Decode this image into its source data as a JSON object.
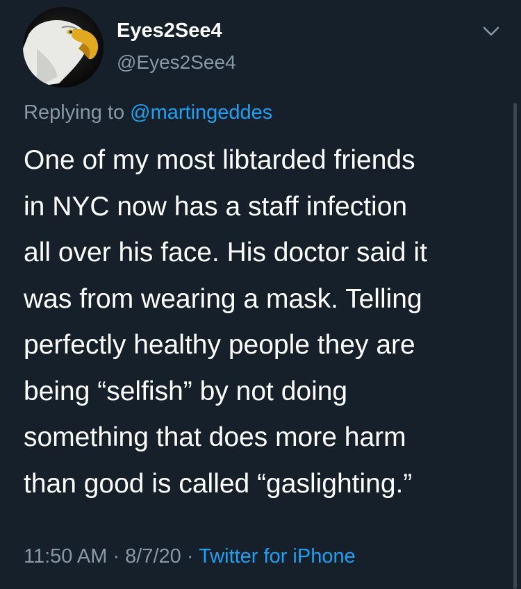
{
  "tweet": {
    "display_name": "Eyes2See4",
    "handle": "@Eyes2See4",
    "replying_prefix": "Replying to",
    "replying_to": "@martingeddes",
    "body_lines": [
      "One of my most libtarded friends",
      "in NYC now has a staff infection",
      "all over his face.  His doctor said it",
      "was from wearing a mask.  Telling",
      "perfectly healthy people they are",
      "being “selfish” by not doing",
      "something that does more harm",
      "than good is called “gaslighting.”"
    ],
    "time": "11:50 AM",
    "separator": " · ",
    "date": "8/7/20",
    "source": "Twitter for iPhone"
  },
  "icons": {
    "avatar": "eagle-avatar",
    "menu": "chevron-down-icon"
  },
  "colors": {
    "background": "#15202b",
    "text": "#ffffff",
    "secondary": "#8899a6",
    "accent": "#1da1f2"
  }
}
